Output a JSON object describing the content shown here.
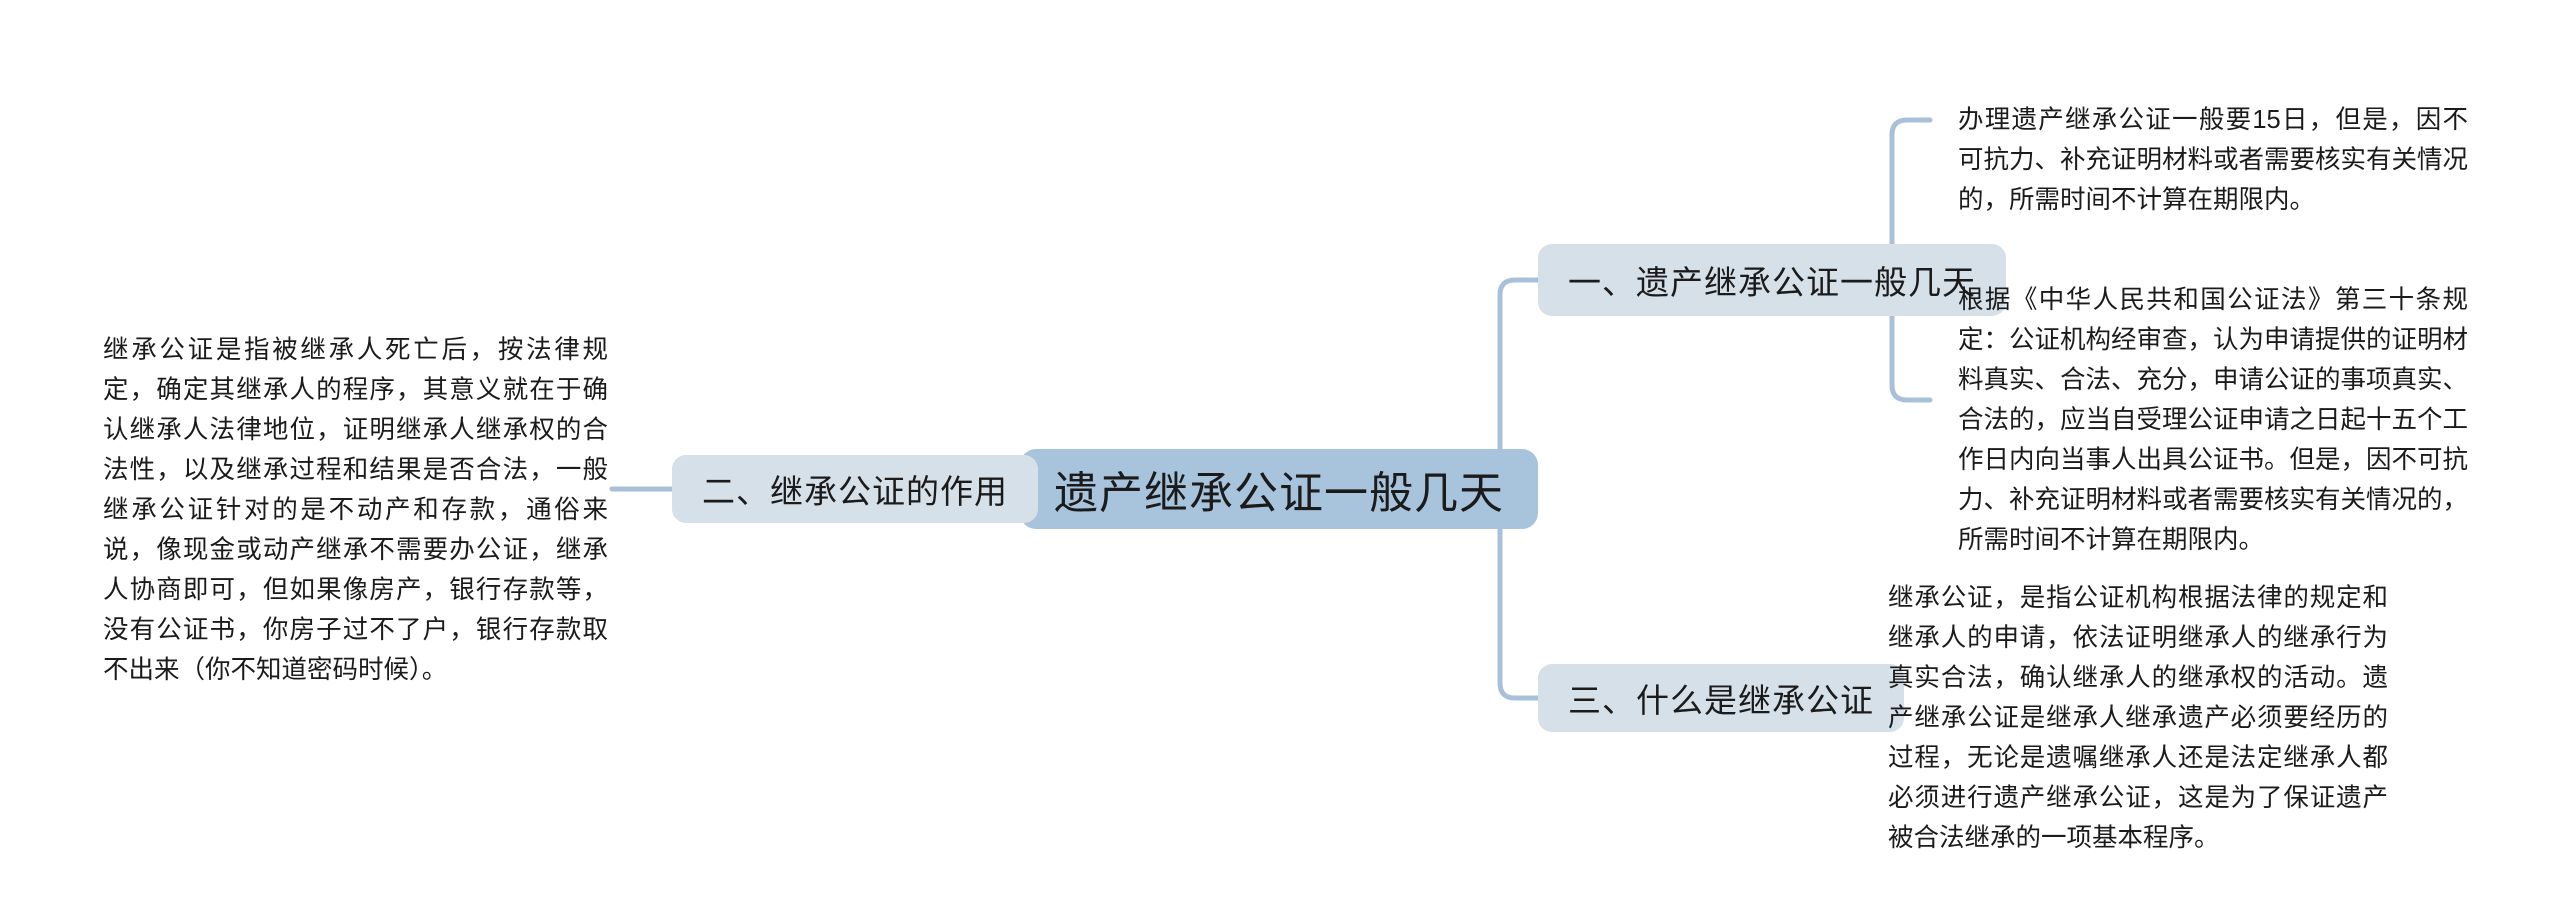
{
  "diagram": {
    "type": "mind-map",
    "title": "遗产继承公证一般几天",
    "background_color": "#ffffff",
    "root_color": "#a8c4dd",
    "branch_color": "#d6e0e8",
    "connector_color": "#a8c0d8",
    "text_color": "#1b1b1b"
  },
  "root": {
    "label": "遗产继承公证一般几天"
  },
  "branches": [
    {
      "id": "branch-1",
      "label": "一、遗产继承公证一般几天",
      "leaves": [
        {
          "id": "leaf-1-1",
          "text": "办理遗产继承公证一般要15日，但是，因不可抗力、补充证明材料或者需要核实有关情况的，所需时间不计算在期限内。"
        },
        {
          "id": "leaf-1-2",
          "text": "根据《中华人民共和国公证法》第三十条规定：公证机构经审查，认为申请提供的证明材料真实、合法、充分，申请公证的事项真实、合法的，应当自受理公证申请之日起十五个工作日内向当事人出具公证书。但是，因不可抗力、补充证明材料或者需要核实有关情况的，所需时间不计算在期限内。"
        }
      ]
    },
    {
      "id": "branch-2",
      "label": "二、继承公证的作用",
      "leaves": [
        {
          "id": "leaf-2-1",
          "text": "继承公证是指被继承人死亡后，按法律规定，确定其继承人的程序，其意义就在于确认继承人法律地位，证明继承人继承权的合法性，以及继承过程和结果是否合法，一般继承公证针对的是不动产和存款，通俗来说，像现金或动产继承不需要办公证，继承人协商即可，但如果像房产，银行存款等，没有公证书，你房子过不了户，银行存款取不出来（你不知道密码时候）。"
        }
      ]
    },
    {
      "id": "branch-3",
      "label": "三、什么是继承公证",
      "leaves": [
        {
          "id": "leaf-3-1",
          "text": "继承公证，是指公证机构根据法律的规定和继承人的申请，依法证明继承人的继承行为真实合法，确认继承人的继承权的活动。遗产继承公证是继承人继承遗产必须要经历的过程，无论是遗嘱继承人还是法定继承人都必须进行遗产继承公证，这是为了保证遗产被合法继承的一项基本程序。"
        }
      ]
    }
  ]
}
